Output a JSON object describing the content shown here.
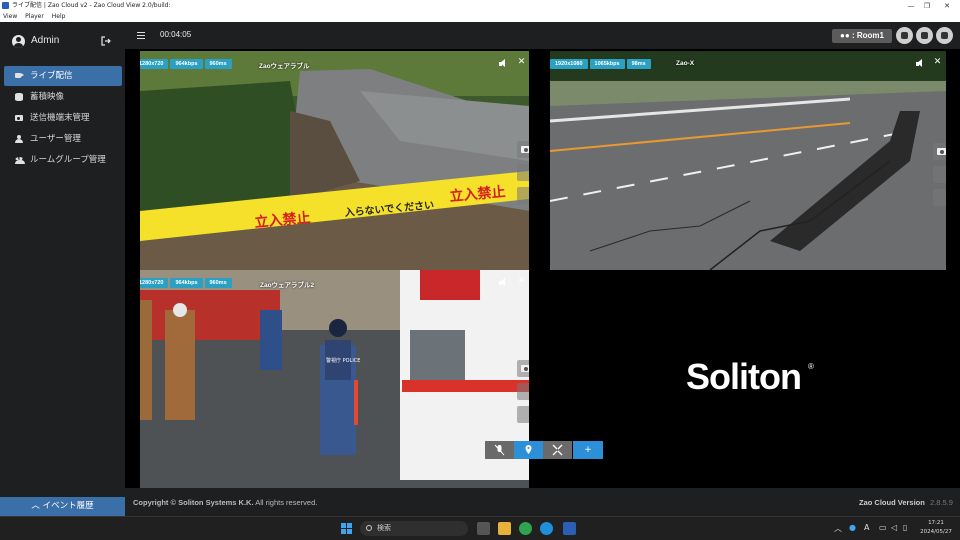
{
  "window": {
    "title": "ライブ配信 | Zao Cloud v2 - Zao Cloud View 2.0/build:",
    "controls": [
      "—",
      "❐",
      "✕"
    ]
  },
  "menubar": [
    "View",
    "Player",
    "Help"
  ],
  "sidebar": {
    "user": "Admin",
    "items": [
      {
        "label": "ライブ配信",
        "icon": "video-icon",
        "active": true
      },
      {
        "label": "蓄積映像",
        "icon": "database-icon",
        "active": false
      },
      {
        "label": "送信機端末管理",
        "icon": "camera-icon",
        "active": false
      },
      {
        "label": "ユーザー管理",
        "icon": "user-icon",
        "active": false
      },
      {
        "label": "ルームグループ管理",
        "icon": "users-icon",
        "active": false
      }
    ],
    "event_history": "イベント履歴"
  },
  "topbar": {
    "elapsed": "00:04:05",
    "room": ": Room1"
  },
  "tiles": [
    {
      "name": "Zaoウェアラブル",
      "resolution": "1280x720",
      "bitrate": "964kbps",
      "latency": "960ms"
    },
    {
      "name": "Zao-X",
      "resolution": "1920x1080",
      "bitrate": "1065kbps",
      "latency": "98ms"
    },
    {
      "name": "Zaoウェアラブル2",
      "resolution": "1280x720",
      "bitrate": "964kbps",
      "latency": "960ms"
    }
  ],
  "scene_text": {
    "tape_a": "立入禁止",
    "tape_b": "入らないでください",
    "police": "警視庁 POLICE"
  },
  "brand": {
    "logo": "Soliton",
    "reg": "®"
  },
  "controls": {
    "plus": "+"
  },
  "footer": {
    "copyright_prefix": "Copyright © Soliton Systems K.K.",
    "copyright_suffix": "All rights reserved.",
    "version_label": "Zao Cloud Version",
    "version_num": "2.8.5.9"
  },
  "taskbar": {
    "search": "検索",
    "clock_time": "17:21",
    "clock_date": "2024/05/27",
    "ime": "A"
  },
  "colors": {
    "accent": "#3a6fa8",
    "badge": "#2ba0c2",
    "sidebar_bg": "#1e1f21",
    "tape": "#f5e12a",
    "tape_text": "#d81e1e"
  }
}
